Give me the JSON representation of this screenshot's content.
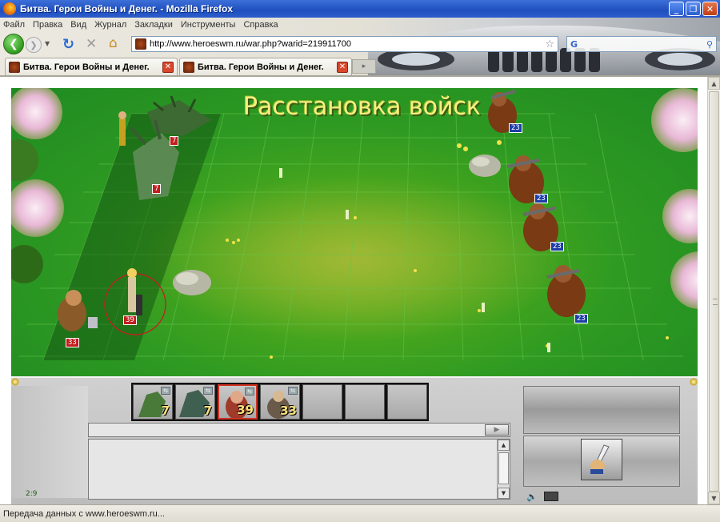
{
  "window": {
    "title": "Битва. Герои Войны и Денег. - Mozilla Firefox",
    "min": "_",
    "max": "❐",
    "close": "✕"
  },
  "menu": [
    "Файл",
    "Правка",
    "Вид",
    "Журнал",
    "Закладки",
    "Инструменты",
    "Справка"
  ],
  "nav": {
    "url": "http://www.heroeswm.ru/war.php?warid=219911700",
    "search_engine_glyph": "G"
  },
  "tabs": [
    {
      "label": "Битва. Герои Войны и Денег."
    },
    {
      "label": "Битва. Герои Войны и Денег."
    }
  ],
  "battle": {
    "title": "Расстановка войск",
    "player_stacks": [
      {
        "name": "hydra",
        "count": "7"
      },
      {
        "name": "dragon-hydra",
        "count": "7"
      },
      {
        "name": "sorceress",
        "count": "39"
      },
      {
        "name": "dwarf-warrior",
        "count": "33"
      }
    ],
    "enemy_stacks": [
      {
        "name": "ogre",
        "count": "23"
      },
      {
        "name": "ogre",
        "count": "23"
      },
      {
        "name": "ogre",
        "count": "23"
      },
      {
        "name": "ogre",
        "count": "23"
      }
    ]
  },
  "panel": {
    "slots": [
      {
        "unit": "hydra",
        "count": "7",
        "active": false
      },
      {
        "unit": "dragon-hydra",
        "count": "7",
        "active": false
      },
      {
        "unit": "sorceress",
        "count": "39",
        "active": true
      },
      {
        "unit": "warrior",
        "count": "33",
        "active": false
      },
      {
        "unit": "",
        "count": "",
        "active": false
      },
      {
        "unit": "",
        "count": "",
        "active": false
      },
      {
        "unit": "",
        "count": "",
        "active": false
      }
    ],
    "chat_value": "",
    "coords": "2:9"
  },
  "status": {
    "text": "Передача данных с www.heroeswm.ru..."
  },
  "colors": {
    "grass": "#2e9a22",
    "title_text": "#f6ef80",
    "player_badge": "#c21e1e",
    "enemy_badge": "#1d3ea8",
    "titlebar": "#1f4fbf"
  }
}
